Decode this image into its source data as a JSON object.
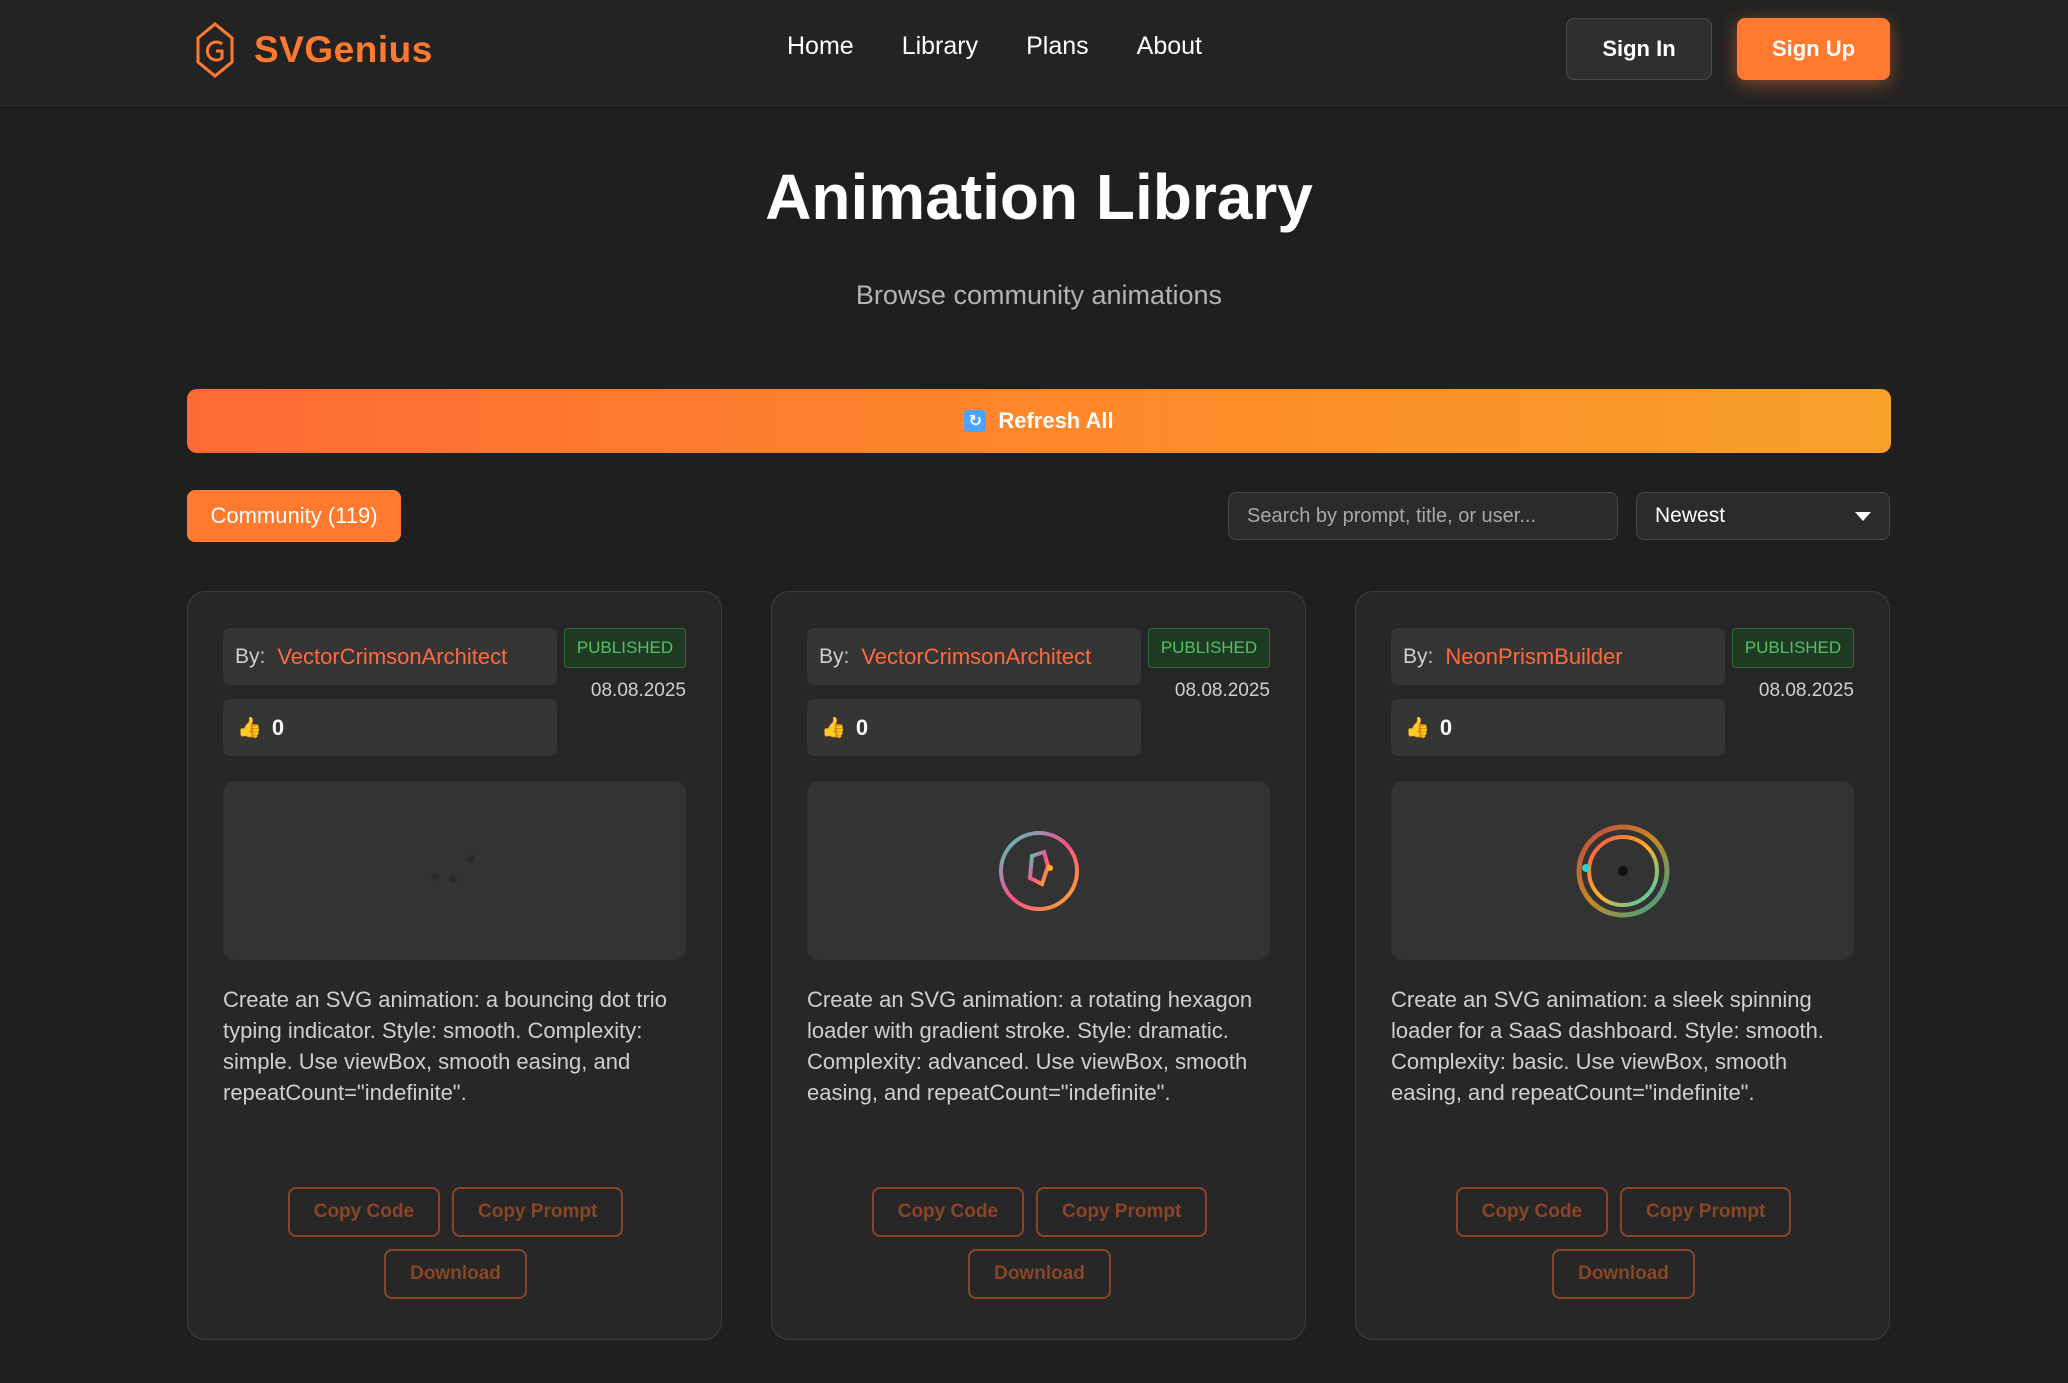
{
  "nav": {
    "brand": "SVGenius",
    "links": [
      "Home",
      "Library",
      "Plans",
      "About"
    ],
    "sign_in": "Sign In",
    "sign_up": "Sign Up",
    "accent": "#ff7a2e"
  },
  "hero": {
    "title": "Animation Library",
    "subtitle": "Browse community animations",
    "refresh_label": "Refresh All"
  },
  "filters": {
    "community_tab": "Community (119)",
    "search_placeholder": "Search by prompt, title, or user...",
    "sort_value": "Newest"
  },
  "cards": [
    {
      "by_label": "By:",
      "author": "VectorCrimsonArchitect",
      "status": "PUBLISHED",
      "date": "08.08.2025",
      "likes": "0",
      "preview_icon": "bouncing-dots",
      "prompt": "Create an SVG animation: a bouncing dot trio typing indicator. Style: smooth. Complexity: simple. Use viewBox, smooth easing, and repeatCount=\"indefinite\".",
      "actions": {
        "copy_code": "Copy Code",
        "copy_prompt": "Copy Prompt",
        "download": "Download"
      }
    },
    {
      "by_label": "By:",
      "author": "VectorCrimsonArchitect",
      "status": "PUBLISHED",
      "date": "08.08.2025",
      "likes": "0",
      "preview_icon": "hexagon-loader",
      "prompt": "Create an SVG animation: a rotating hexagon loader with gradient stroke. Style: dramatic. Complexity: advanced. Use viewBox, smooth easing, and repeatCount=\"indefinite\".",
      "actions": {
        "copy_code": "Copy Code",
        "copy_prompt": "Copy Prompt",
        "download": "Download"
      }
    },
    {
      "by_label": "By:",
      "author": "NeonPrismBuilder",
      "status": "PUBLISHED",
      "date": "08.08.2025",
      "likes": "0",
      "preview_icon": "spinning-loader",
      "prompt": "Create an SVG animation: a sleek spinning loader for a SaaS dashboard. Style: smooth. Complexity: basic. Use viewBox, smooth easing, and repeatCount=\"indefinite\".",
      "actions": {
        "copy_code": "Copy Code",
        "copy_prompt": "Copy Prompt",
        "download": "Download"
      }
    }
  ]
}
